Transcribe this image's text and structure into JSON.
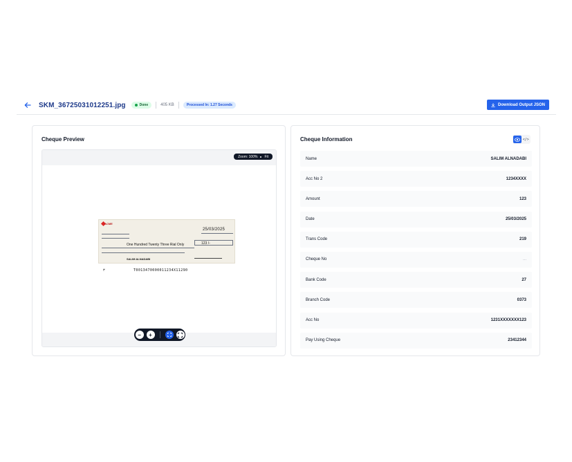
{
  "header": {
    "file_name": "SKM_36725031012251.jpg",
    "status": "Done",
    "file_size": "405 KB",
    "processed": "Processed In: 1.27 Seconds",
    "download_label": "Download Output JSON"
  },
  "preview": {
    "title": "Cheque Preview",
    "zoom_label": "Zoom: 100%",
    "fit_label": "Fit",
    "cheque": {
      "bank": "ACME",
      "date": "25/03/2025",
      "amount_words": "One Hundred Twenty Three Rial Only",
      "amount": "123 /-",
      "payee": "SALIM ALNADABI",
      "micr": "T0013470000011234X11290",
      "micr_left": "٣"
    },
    "controls": {
      "zoom_out": "−",
      "zoom_in": "+",
      "fit": "⤢",
      "fullscreen": "⛶"
    }
  },
  "info": {
    "title": "Cheque Information",
    "code_label": "</>",
    "rows": [
      {
        "label": "Name",
        "value": "SALIM ALNADABI"
      },
      {
        "label": "Acc No 2",
        "value": "1234XXXX"
      },
      {
        "label": "Amount",
        "value": "123"
      },
      {
        "label": "Date",
        "value": "25/03/2025"
      },
      {
        "label": "Trans Code",
        "value": "219"
      },
      {
        "label": "Cheque No",
        "value": "..."
      },
      {
        "label": "Bank Code",
        "value": "27"
      },
      {
        "label": "Branch Code",
        "value": "0373"
      },
      {
        "label": "Acc No",
        "value": "1231XXXXXXX123"
      },
      {
        "label": "Pay Using Cheque",
        "value": "23412344"
      }
    ]
  },
  "colors": {
    "accent": "#2563eb",
    "title_blue": "#1e3a8a",
    "done_green": "#16a34a"
  }
}
